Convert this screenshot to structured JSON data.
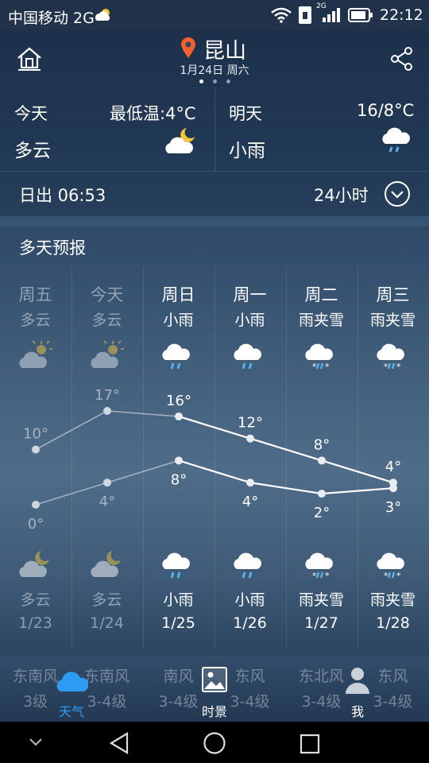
{
  "status_bar": {
    "carrier": "中国移动 2G",
    "network_badge": "2G",
    "time": "22:12",
    "icons": [
      "cloud-icon",
      "wifi-icon",
      "sim-icon",
      "signal-icon",
      "battery-icon"
    ]
  },
  "header": {
    "city": "昆山",
    "date": "1月24日 周六",
    "page_dots": 3,
    "active_dot": 0
  },
  "today": {
    "label": "今天",
    "low_temp": "最低温:4°C",
    "condition": "多云",
    "icon": "cloudy-night-icon"
  },
  "tomorrow": {
    "label": "明天",
    "temp_range": "16/8°C",
    "condition": "小雨",
    "icon": "light-rain-icon"
  },
  "sunrise": {
    "text": "日出 06:53",
    "toggle_label": "24小时"
  },
  "forecast": {
    "title": "多天预报",
    "days": [
      {
        "day": "周五",
        "cond": "多云",
        "high": "10°",
        "low": "0°",
        "night_cond": "多云",
        "date": "1/23",
        "past": true,
        "day_icon": "cloudy-sun-icon",
        "night_icon": "cloudy-night-icon",
        "wind_dir": "东南风",
        "wind_level": "3级"
      },
      {
        "day": "今天",
        "cond": "多云",
        "high": "17°",
        "low": "4°",
        "night_cond": "多云",
        "date": "1/24",
        "past": true,
        "day_icon": "cloudy-sun-icon",
        "night_icon": "cloudy-night-icon",
        "wind_dir": "东南风",
        "wind_level": "3-4级"
      },
      {
        "day": "周日",
        "cond": "小雨",
        "high": "16°",
        "low": "8°",
        "night_cond": "小雨",
        "date": "1/25",
        "past": false,
        "day_icon": "light-rain-icon",
        "night_icon": "light-rain-icon",
        "wind_dir": "南风",
        "wind_level": "3-4级"
      },
      {
        "day": "周一",
        "cond": "小雨",
        "high": "12°",
        "low": "4°",
        "night_cond": "小雨",
        "date": "1/26",
        "past": false,
        "day_icon": "light-rain-icon",
        "night_icon": "light-rain-icon",
        "wind_dir": "东风",
        "wind_level": "3-4级"
      },
      {
        "day": "周二",
        "cond": "雨夹雪",
        "high": "8°",
        "low": "2°",
        "night_cond": "雨夹雪",
        "date": "1/27",
        "past": false,
        "day_icon": "sleet-icon",
        "night_icon": "sleet-icon",
        "wind_dir": "东北风",
        "wind_level": "3-4级"
      },
      {
        "day": "周三",
        "cond": "雨夹雪",
        "high": "4°",
        "low": "3°",
        "night_cond": "雨夹雪",
        "date": "1/28",
        "past": false,
        "day_icon": "sleet-icon",
        "night_icon": "sleet-icon",
        "wind_dir": "东风",
        "wind_level": "3-4级"
      }
    ]
  },
  "chart_data": {
    "type": "line",
    "categories": [
      "1/23",
      "1/24",
      "1/25",
      "1/26",
      "1/27",
      "1/28"
    ],
    "series": [
      {
        "values": [
          10,
          17,
          16,
          12,
          8,
          4
        ]
      },
      {
        "values": [
          0,
          4,
          8,
          4,
          2,
          3
        ]
      }
    ],
    "ylim": [
      0,
      17
    ]
  },
  "bottom_nav": {
    "items": [
      {
        "label": "天气",
        "icon": "cloud-icon",
        "active": true
      },
      {
        "label": "时景",
        "icon": "picture-icon",
        "active": false
      },
      {
        "label": "我",
        "icon": "user-icon",
        "active": false
      }
    ]
  },
  "colors": {
    "accent": "#2d9cf0",
    "location_pin": "#f5602c"
  }
}
